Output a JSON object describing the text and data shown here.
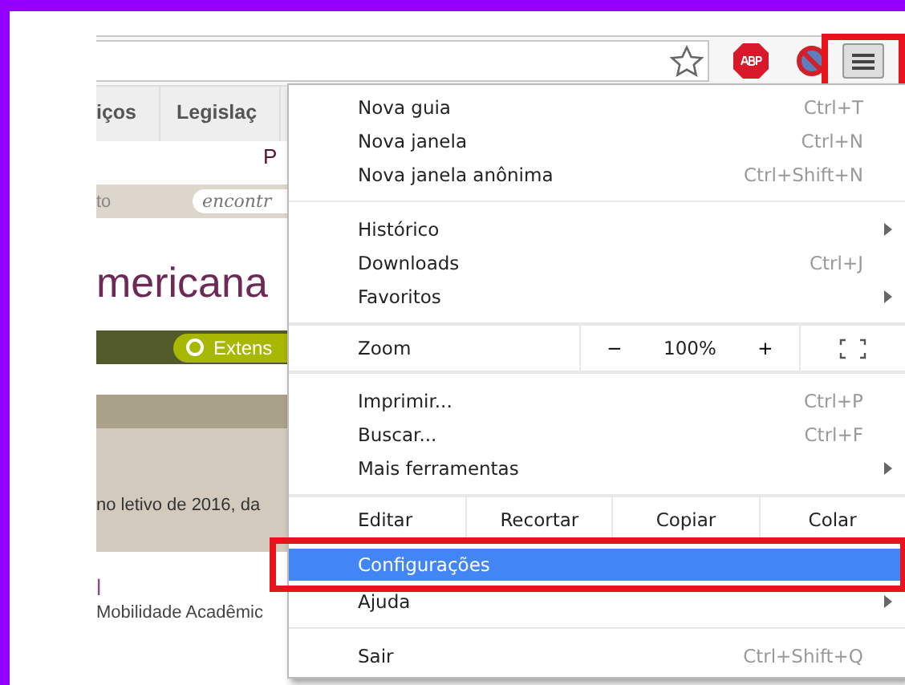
{
  "toolbar": {
    "menu_button_annotated": true
  },
  "page": {
    "nav_tabs": [
      "iços",
      "Legislaç"
    ],
    "subnav_text": "P",
    "search_label": "to",
    "search_placeholder": "encontr",
    "heading": "mericana",
    "pill": "Extens",
    "notice": "no letivo de 2016, da",
    "link_title": "l",
    "link_subtitle": "Mobilidade Acadêmic"
  },
  "menu": {
    "items": [
      {
        "kind": "item",
        "label": "Nova guia",
        "shortcut": "Ctrl+T",
        "submenu": false,
        "selected": false,
        "annotated": false
      },
      {
        "kind": "item",
        "label": "Nova janela",
        "shortcut": "Ctrl+N",
        "submenu": false,
        "selected": false,
        "annotated": false
      },
      {
        "kind": "item",
        "label": "Nova janela anônima",
        "shortcut": "Ctrl+Shift+N",
        "submenu": false,
        "selected": false,
        "annotated": false
      },
      {
        "kind": "separator"
      },
      {
        "kind": "item",
        "label": "Histórico",
        "submenu": true,
        "selected": false,
        "annotated": false
      },
      {
        "kind": "item",
        "label": "Downloads",
        "shortcut": "Ctrl+J",
        "submenu": false,
        "selected": false,
        "annotated": false
      },
      {
        "kind": "item",
        "label": "Favoritos",
        "submenu": true,
        "selected": false,
        "annotated": false
      },
      {
        "kind": "separator"
      },
      {
        "kind": "zoom",
        "label": "Zoom",
        "minus": "−",
        "value": "100%",
        "plus": "+"
      },
      {
        "kind": "separator"
      },
      {
        "kind": "item",
        "label": "Imprimir...",
        "shortcut": "Ctrl+P",
        "submenu": false,
        "selected": false,
        "annotated": false
      },
      {
        "kind": "item",
        "label": "Buscar...",
        "shortcut": "Ctrl+F",
        "submenu": false,
        "selected": false,
        "annotated": false
      },
      {
        "kind": "item",
        "label": "Mais ferramentas",
        "submenu": true,
        "selected": false,
        "annotated": false
      },
      {
        "kind": "separator"
      },
      {
        "kind": "edit",
        "label": "Editar",
        "actions": [
          "Recortar",
          "Copiar",
          "Colar"
        ]
      },
      {
        "kind": "item",
        "label": "Configurações",
        "submenu": false,
        "selected": true,
        "annotated": true
      },
      {
        "kind": "item",
        "label": "Ajuda",
        "submenu": true,
        "selected": false,
        "annotated": false
      },
      {
        "kind": "separator"
      },
      {
        "kind": "item",
        "label": "Sair",
        "shortcut": "Ctrl+Shift+Q",
        "submenu": false,
        "selected": false,
        "annotated": false
      }
    ]
  }
}
